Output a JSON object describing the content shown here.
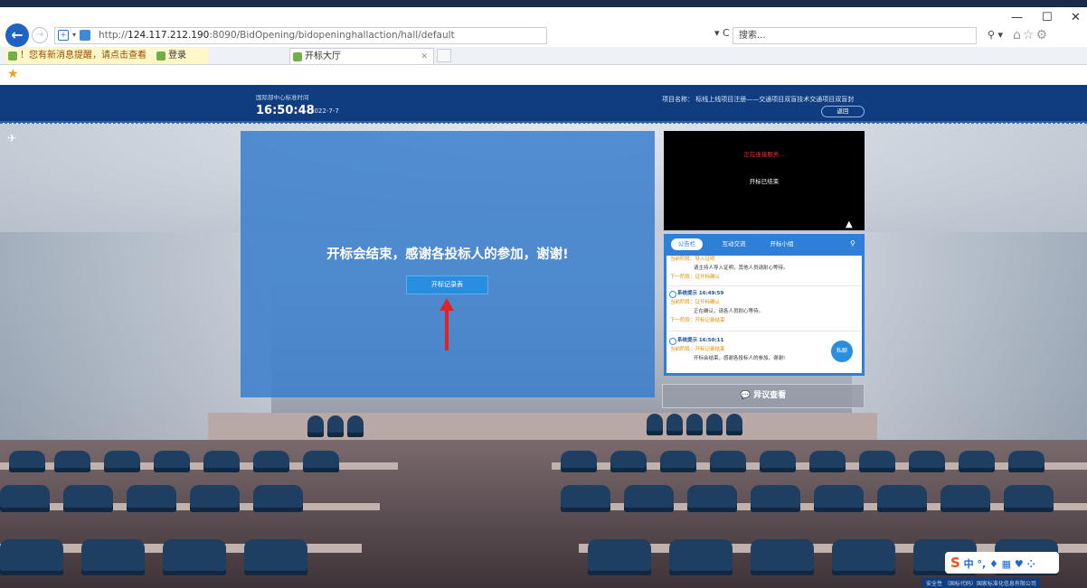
{
  "browser": {
    "url_prefix": "http://",
    "url_host": "124.117.212.190",
    "url_rest": ":8090/BidOpening/bidopeninghallaction/hall/default",
    "refresh_icon": "refresh-icon",
    "search_placeholder": "搜索...",
    "tabs": [
      {
        "label": "！您有新消息提醒，请点击查看"
      },
      {
        "label": "登录"
      },
      {
        "label": "开标大厅"
      }
    ],
    "controls": {
      "minimize": "—",
      "maximize": "☐",
      "close": "✕"
    },
    "tool_icons": "⌂☆⚙"
  },
  "header": {
    "time_label": "国际部中心标准时间",
    "time": "16:50:48",
    "date": "2022-7-7",
    "project_label": "项目名称：  标线上线项目注册——交通项目双盲技术交通项目双盲封",
    "back_button": "返回"
  },
  "main": {
    "message": "开标会结束，感谢各投标人的参加，谢谢!",
    "record_button": "开标记录表"
  },
  "video": {
    "error_text": "正在连接服务...",
    "status_text": "开标已结束"
  },
  "chat": {
    "tabs": [
      "公告栏",
      "互动交流",
      "开标小组"
    ],
    "messages": [
      {
        "phase": "当前阶段：导入证明",
        "text": "请主持人导入证明，其他人员请耐心等待。",
        "next": "下一阶段：证开标确认"
      },
      {
        "who": "系统提示 16:49:59",
        "phase": "当前阶段：证开标确认",
        "text": "正在确认，请各人员耐心等待。",
        "next": "下一阶段：开标记录结束"
      },
      {
        "who": "系统提示 16:50:11",
        "phase": "当前阶段：开标记录结束",
        "text": "开标会结束，感谢各投标人的参加，谢谢!"
      }
    ],
    "fab_label": "私聊"
  },
  "objection_button": "异议查看",
  "ime": {
    "text": "中 °, ♦ ▦ ♥ ⁘"
  },
  "footer": "安全性 （国标代码）国家标准化信息有限公司",
  "colors": {
    "header_bg": "#0f3d7f",
    "panel_blue": "#3a7ecd",
    "button_blue": "#2a8ee0",
    "arrow_red": "#e2222b"
  }
}
